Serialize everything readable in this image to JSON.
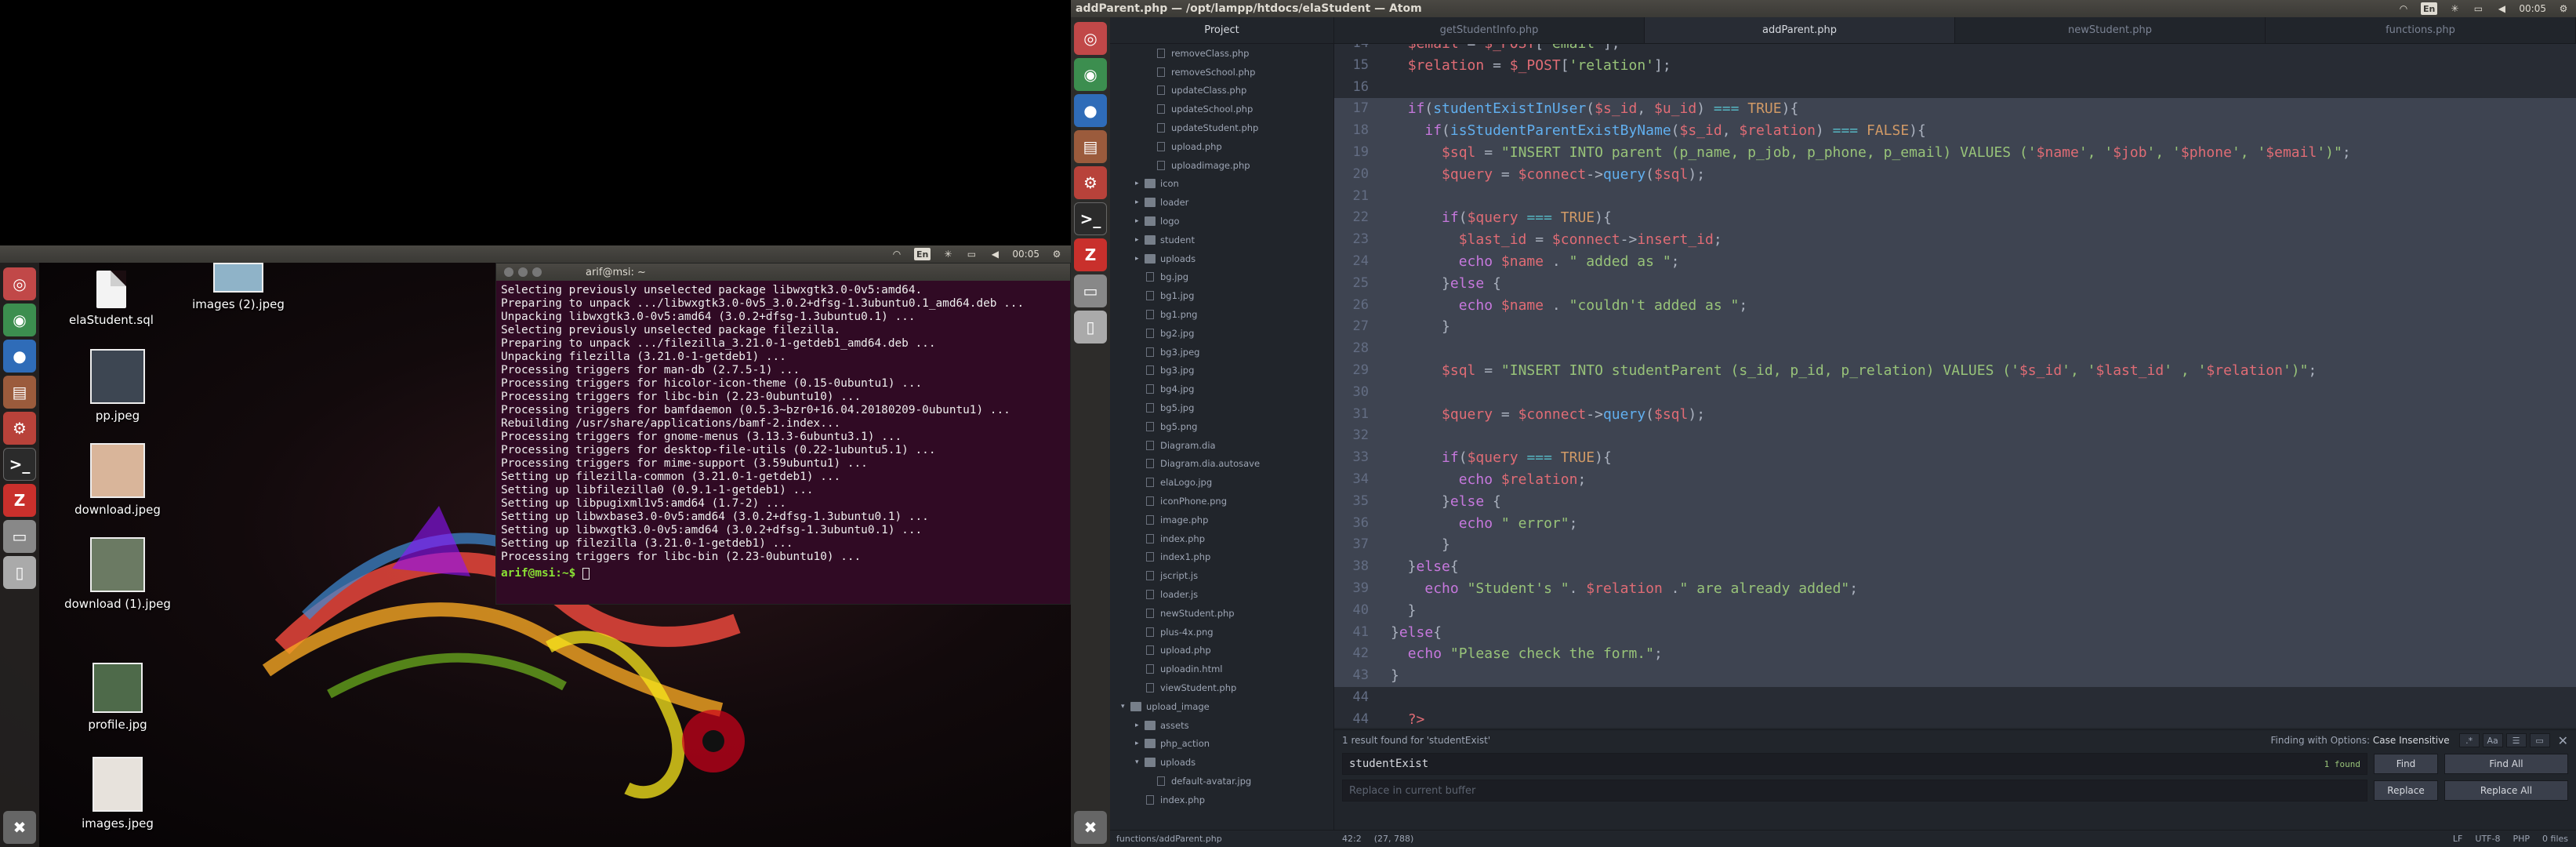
{
  "left_panel": {
    "keyboard": "En",
    "time": "00:05"
  },
  "desktop_icons": [
    {
      "label": "elaStudent.sql"
    },
    {
      "label": "images (2).jpeg"
    },
    {
      "label": "pp.jpeg"
    },
    {
      "label": "download.jpeg"
    },
    {
      "label": "download (1).jpeg"
    },
    {
      "label": "profile.jpg"
    },
    {
      "label": "images.jpeg"
    }
  ],
  "terminal": {
    "title": "arif@msi: ~",
    "lines": "Selecting previously unselected package libwxgtk3.0-0v5:amd64.\nPreparing to unpack .../libwxgtk3.0-0v5_3.0.2+dfsg-1.3ubuntu0.1_amd64.deb ...\nUnpacking libwxgtk3.0-0v5:amd64 (3.0.2+dfsg-1.3ubuntu0.1) ...\nSelecting previously unselected package filezilla.\nPreparing to unpack .../filezilla_3.21.0-1-getdeb1_amd64.deb ...\nUnpacking filezilla (3.21.0-1-getdeb1) ...\nProcessing triggers for man-db (2.7.5-1) ...\nProcessing triggers for hicolor-icon-theme (0.15-0ubuntu1) ...\nProcessing triggers for libc-bin (2.23-0ubuntu10) ...\nProcessing triggers for bamfdaemon (0.5.3~bzr0+16.04.20180209-0ubuntu1) ...\nRebuilding /usr/share/applications/bamf-2.index...\nProcessing triggers for gnome-menus (3.13.3-6ubuntu3.1) ...\nProcessing triggers for desktop-file-utils (0.22-1ubuntu5.1) ...\nProcessing triggers for mime-support (3.59ubuntu1) ...\nSetting up filezilla-common (3.21.0-1-getdeb1) ...\nSetting up libfilezilla0 (0.9.1-1-getdeb1) ...\nSetting up libpugixml1v5:amd64 (1.7-2) ...\nSetting up libwxbase3.0-0v5:amd64 (3.0.2+dfsg-1.3ubuntu0.1) ...\nSetting up libwxgtk3.0-0v5:amd64 (3.0.2+dfsg-1.3ubuntu0.1) ...\nSetting up filezilla (3.21.0-1-getdeb1) ...\nProcessing triggers for libc-bin (2.23-0ubuntu10) ...",
    "prompt": "arif@msi:~$"
  },
  "top_panel": {
    "window_title": "addParent.php — /opt/lampp/htdocs/elaStudent — Atom",
    "keyboard": "En",
    "time": "00:05"
  },
  "tree": {
    "header": "Project",
    "items": [
      {
        "label": "removeClass.php",
        "kind": "file",
        "depth": 2
      },
      {
        "label": "removeSchool.php",
        "kind": "file",
        "depth": 2
      },
      {
        "label": "updateClass.php",
        "kind": "file",
        "depth": 2
      },
      {
        "label": "updateSchool.php",
        "kind": "file",
        "depth": 2
      },
      {
        "label": "updateStudent.php",
        "kind": "file",
        "depth": 2
      },
      {
        "label": "upload.php",
        "kind": "file",
        "depth": 2
      },
      {
        "label": "uploadimage.php",
        "kind": "file",
        "depth": 2
      },
      {
        "label": "icon",
        "kind": "folder",
        "depth": 1
      },
      {
        "label": "loader",
        "kind": "folder",
        "depth": 1
      },
      {
        "label": "logo",
        "kind": "folder",
        "depth": 1
      },
      {
        "label": "student",
        "kind": "folder",
        "depth": 1
      },
      {
        "label": "uploads",
        "kind": "folder",
        "depth": 1
      },
      {
        "label": "bg.jpg",
        "kind": "file",
        "depth": 1
      },
      {
        "label": "bg1.jpg",
        "kind": "file",
        "depth": 1
      },
      {
        "label": "bg1.png",
        "kind": "file",
        "depth": 1
      },
      {
        "label": "bg2.jpg",
        "kind": "file",
        "depth": 1
      },
      {
        "label": "bg3.jpeg",
        "kind": "file",
        "depth": 1
      },
      {
        "label": "bg3.jpg",
        "kind": "file",
        "depth": 1
      },
      {
        "label": "bg4.jpg",
        "kind": "file",
        "depth": 1
      },
      {
        "label": "bg5.jpg",
        "kind": "file",
        "depth": 1
      },
      {
        "label": "bg5.png",
        "kind": "file",
        "depth": 1
      },
      {
        "label": "Diagram.dia",
        "kind": "file",
        "depth": 1
      },
      {
        "label": "Diagram.dia.autosave",
        "kind": "file",
        "depth": 1
      },
      {
        "label": "elaLogo.jpg",
        "kind": "file",
        "depth": 1
      },
      {
        "label": "iconPhone.png",
        "kind": "file",
        "depth": 1
      },
      {
        "label": "image.php",
        "kind": "file",
        "depth": 1
      },
      {
        "label": "index.php",
        "kind": "file",
        "depth": 1
      },
      {
        "label": "index1.php",
        "kind": "file",
        "depth": 1
      },
      {
        "label": "jscript.js",
        "kind": "file",
        "depth": 1
      },
      {
        "label": "loader.js",
        "kind": "file",
        "depth": 1
      },
      {
        "label": "newStudent.php",
        "kind": "file",
        "depth": 1
      },
      {
        "label": "plus-4x.png",
        "kind": "file",
        "depth": 1
      },
      {
        "label": "upload.php",
        "kind": "file",
        "depth": 1
      },
      {
        "label": "uploadin.html",
        "kind": "file",
        "depth": 1
      },
      {
        "label": "viewStudent.php",
        "kind": "file",
        "depth": 1
      },
      {
        "label": "upload_image",
        "kind": "folder-open",
        "depth": 0
      },
      {
        "label": "assets",
        "kind": "folder",
        "depth": 1
      },
      {
        "label": "php_action",
        "kind": "folder",
        "depth": 1
      },
      {
        "label": "uploads",
        "kind": "folder-open",
        "depth": 1
      },
      {
        "label": "default-avatar.jpg",
        "kind": "file",
        "depth": 2
      },
      {
        "label": "index.php",
        "kind": "file",
        "depth": 1
      }
    ]
  },
  "tabs": [
    {
      "label": "getStudentInfo.php",
      "active": false
    },
    {
      "label": "addParent.php",
      "active": true
    },
    {
      "label": "newStudent.php",
      "active": false
    },
    {
      "label": "functions.php",
      "active": false
    }
  ],
  "code_lines": [
    {
      "n": "14",
      "sel": false
    },
    {
      "n": "15",
      "sel": false
    },
    {
      "n": "16",
      "sel": true
    },
    {
      "n": "17",
      "sel": true
    },
    {
      "n": "18",
      "sel": true
    },
    {
      "n": "19",
      "sel": true
    },
    {
      "n": "20",
      "sel": true
    },
    {
      "n": "21",
      "sel": true
    },
    {
      "n": "22",
      "sel": true
    },
    {
      "n": "23",
      "sel": true
    },
    {
      "n": "24",
      "sel": true
    },
    {
      "n": "25",
      "sel": true
    },
    {
      "n": "26",
      "sel": true
    },
    {
      "n": "27",
      "sel": true
    },
    {
      "n": "28",
      "sel": true
    },
    {
      "n": "29",
      "sel": true
    },
    {
      "n": "30",
      "sel": true
    },
    {
      "n": "31",
      "sel": true
    },
    {
      "n": "32",
      "sel": true
    },
    {
      "n": "33",
      "sel": true
    },
    {
      "n": "34",
      "sel": true
    },
    {
      "n": "35",
      "sel": true
    },
    {
      "n": "36",
      "sel": true
    },
    {
      "n": "37",
      "sel": true
    },
    {
      "n": "38",
      "sel": true
    },
    {
      "n": "39",
      "sel": true
    },
    {
      "n": "40",
      "sel": true
    },
    {
      "n": "41",
      "sel": true
    },
    {
      "n": "42",
      "sel": true
    },
    {
      "n": "43",
      "sel": false
    },
    {
      "n": "44",
      "sel": false
    }
  ],
  "find": {
    "result_text": "1 result found for 'studentExist'",
    "options_label": "Finding with Options:",
    "options_value": "Case Insensitive",
    "query": "studentExist",
    "count": "1 found",
    "replace_placeholder": "Replace in current buffer",
    "find_btn": "Find",
    "find_all_btn": "Find All",
    "replace_btn": "Replace",
    "replace_all_btn": "Replace All"
  },
  "status": {
    "path": "functions/addParent.php",
    "cursor": "42:2",
    "selection": "(27, 788)",
    "line_ending": "LF",
    "encoding": "UTF-8",
    "grammar": "PHP",
    "files": "0 files"
  }
}
